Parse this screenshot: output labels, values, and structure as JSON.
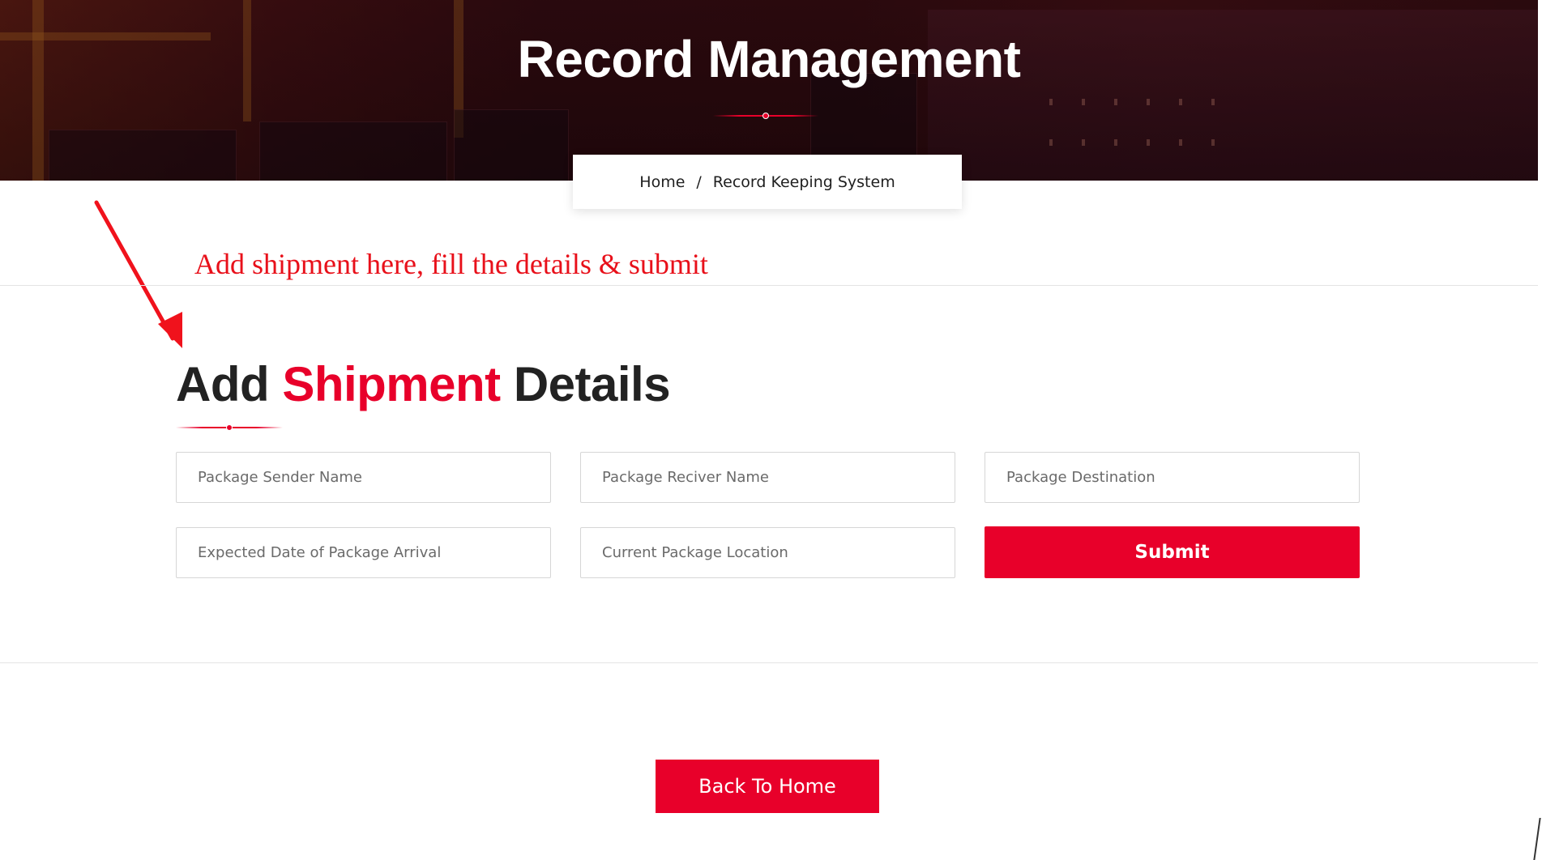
{
  "hero": {
    "title": "Record Management"
  },
  "breadcrumb": {
    "home": "Home",
    "separator": "/",
    "current": "Record Keeping System"
  },
  "annotation": {
    "text": "Add shipment here, fill the details & submit"
  },
  "form": {
    "title_part1": "Add ",
    "title_accent": "Shipment",
    "title_part2": " Details",
    "fields": [
      {
        "placeholder": "Package Sender Name",
        "value": ""
      },
      {
        "placeholder": "Package Reciver Name",
        "value": ""
      },
      {
        "placeholder": "Package Destination",
        "value": ""
      },
      {
        "placeholder": "Expected Date of Package Arrival",
        "value": ""
      },
      {
        "placeholder": "Current Package Location",
        "value": ""
      }
    ],
    "submit_label": "Submit"
  },
  "footer": {
    "back_label": "Back To Home"
  },
  "colors": {
    "accent": "#e8002a",
    "annotation": "#e8101a",
    "heading": "#222222"
  }
}
